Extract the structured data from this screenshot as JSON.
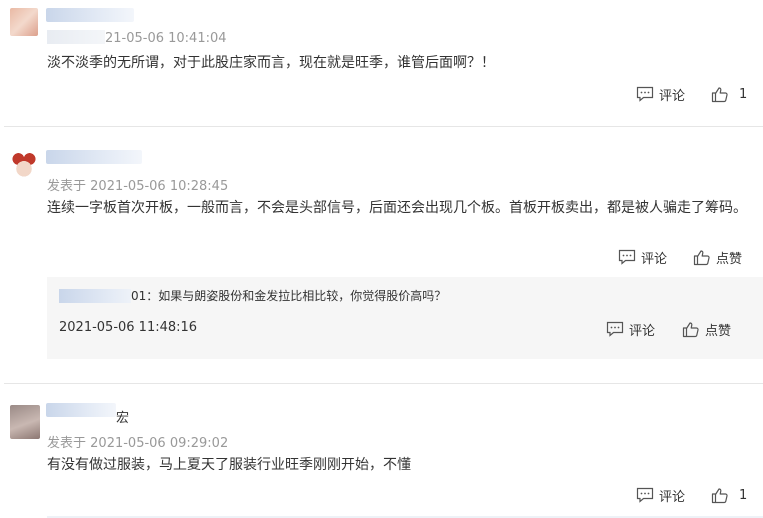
{
  "comments": [
    {
      "name_suffix": "",
      "date_prefix": "",
      "date": "21-05-06 10:41:04",
      "text": "淡不淡季的无所谓，对于此股庄家而言，现在就是旺季，谁管后面啊？！",
      "comment_label": "评论",
      "like_label": "1"
    },
    {
      "name_suffix": "",
      "date_prefix": "发表于",
      "date": "2021-05-06 10:28:45",
      "text": "连续一字板首次开板，一般而言，不会是头部信号，后面还会出现几个板。首板开板卖出，都是被人骗走了筹码。",
      "comment_label": "评论",
      "like_label": "点赞",
      "reply": {
        "name_suffix": "01",
        "text": "：如果与朗姿股份和金发拉比相比较，你觉得股价高吗？",
        "date": "2021-05-06 11:48:16",
        "comment_label": "评论",
        "like_label": "点赞"
      }
    },
    {
      "name_suffix": "宏",
      "date_prefix": "发表于",
      "date": "2021-05-06 09:29:02",
      "text": "有没有做过服装，马上夏天了服装行业旺季刚刚开始，不懂",
      "comment_label": "评论",
      "like_label": "1"
    }
  ],
  "icons": {
    "comment": "comment-bubble-icon",
    "like": "thumbs-up-icon"
  },
  "colors": {
    "meta": "#999999",
    "text": "#333333",
    "reply_bg": "#f6f6f6",
    "divider": "#e6e6e6"
  }
}
